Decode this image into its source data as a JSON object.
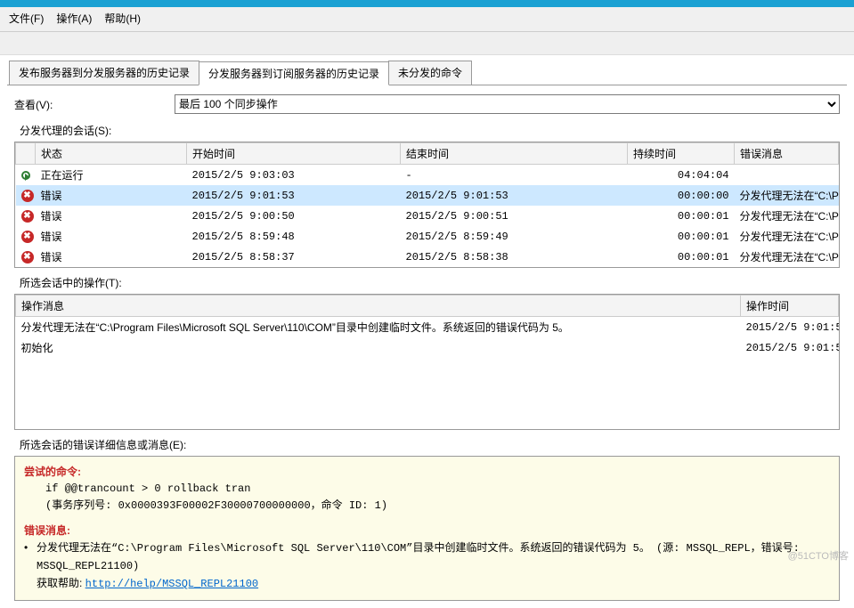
{
  "menu": {
    "file": "文件(F)",
    "action": "操作(A)",
    "help": "帮助(H)"
  },
  "tabs": {
    "t0": "发布服务器到分发服务器的历史记录",
    "t1": "分发服务器到订阅服务器的历史记录",
    "t2": "未分发的命令"
  },
  "view": {
    "label": "查看(V):",
    "value": "最后 100 个同步操作"
  },
  "sessions": {
    "label": "分发代理的会话(S):",
    "cols": {
      "c0": "状态",
      "c1": "开始时间",
      "c2": "结束时间",
      "c3": "持续时间",
      "c4": "错误消息"
    },
    "rows": [
      {
        "st": "run",
        "txt": "正在运行",
        "start": "2015/2/5 9:03:03",
        "end": "-",
        "dur": "04:04:04",
        "err": ""
      },
      {
        "st": "err",
        "txt": "错误",
        "start": "2015/2/5 9:01:53",
        "end": "2015/2/5 9:01:53",
        "dur": "00:00:00",
        "err": "分发代理无法在“C:\\Pr"
      },
      {
        "st": "err",
        "txt": "错误",
        "start": "2015/2/5 9:00:50",
        "end": "2015/2/5 9:00:51",
        "dur": "00:00:01",
        "err": "分发代理无法在“C:\\Pr"
      },
      {
        "st": "err",
        "txt": "错误",
        "start": "2015/2/5 8:59:48",
        "end": "2015/2/5 8:59:49",
        "dur": "00:00:01",
        "err": "分发代理无法在“C:\\Pr"
      },
      {
        "st": "err",
        "txt": "错误",
        "start": "2015/2/5 8:58:37",
        "end": "2015/2/5 8:58:38",
        "dur": "00:00:01",
        "err": "分发代理无法在“C:\\Pr"
      }
    ]
  },
  "ops": {
    "label": "所选会话中的操作(T):",
    "cols": {
      "c0": "操作消息",
      "c1": "操作时间"
    },
    "rows": [
      {
        "msg": "分发代理无法在“C:\\Program Files\\Microsoft SQL Server\\110\\COM”目录中创建临时文件。系统返回的错误代码为 5。",
        "time": "2015/2/5 9:01:5"
      },
      {
        "msg": "初始化",
        "time": "2015/2/5 9:01:5"
      }
    ]
  },
  "detail": {
    "label": "所选会话的错误详细信息或消息(E):",
    "cmd_hdr": "尝试的命令:",
    "cmd1": "if @@trancount > 0 rollback tran",
    "cmd2": "(事务序列号: 0x0000393F00002F30000700000000，命令 ID: 1)",
    "err_hdr": "错误消息:",
    "err1": "分发代理无法在“C:\\Program Files\\Microsoft SQL Server\\110\\COM”目录中创建临时文件。系统返回的错误代码为 5。 (源: MSSQL_REPL，错误号: MSSQL_REPL21100)",
    "helppre": "获取帮助: ",
    "helpurl": "http://help/MSSQL_REPL21100"
  },
  "watermark": "@51CTO博客"
}
